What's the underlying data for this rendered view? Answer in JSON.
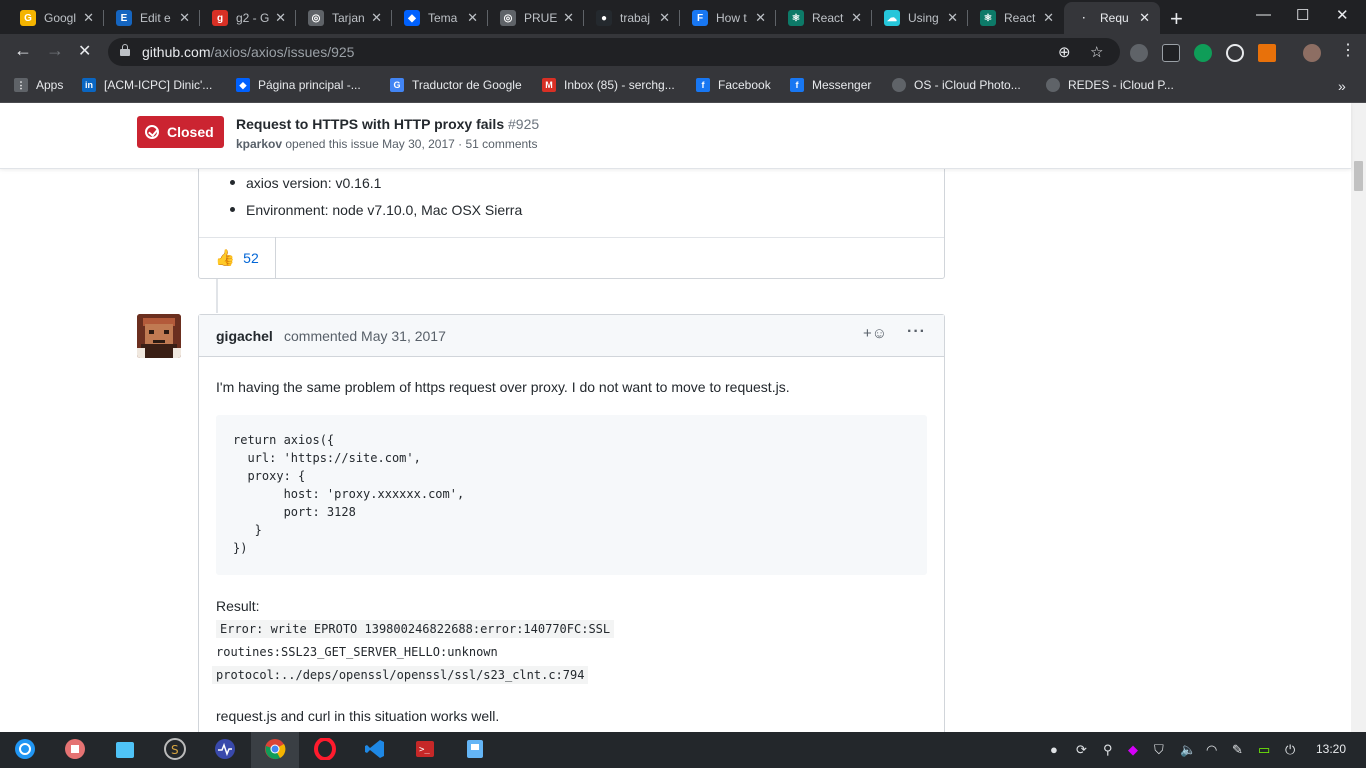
{
  "tabs": [
    {
      "label": "Googl",
      "fav_color": "#f4b400",
      "fav_char": "G"
    },
    {
      "label": "Edit e",
      "fav_color": "#1565c0",
      "fav_char": "E"
    },
    {
      "label": "g2 - G",
      "fav_color": "#d93025",
      "fav_char": "g"
    },
    {
      "label": "Tarjan",
      "fav_color": "#5f6368",
      "fav_char": "◎"
    },
    {
      "label": "Tema",
      "fav_color": "#0061fe",
      "fav_char": "◆"
    },
    {
      "label": "PRUE",
      "fav_color": "#5f6368",
      "fav_char": "◎"
    },
    {
      "label": "trabaj",
      "fav_color": "#24292e",
      "fav_char": "●"
    },
    {
      "label": "How t",
      "fav_color": "#1877f2",
      "fav_char": "F"
    },
    {
      "label": "React",
      "fav_color": "#0d7a68",
      "fav_char": "⚛"
    },
    {
      "label": "Using",
      "fav_color": "#26c6da",
      "fav_char": "☁"
    },
    {
      "label": "React",
      "fav_color": "#0d7a68",
      "fav_char": "⚛"
    },
    {
      "label": "Requ",
      "fav_color": "#35363a",
      "fav_char": "·"
    }
  ],
  "address": {
    "host": "github.com",
    "path": "/axios/axios/issues/925"
  },
  "bookmarks": [
    {
      "label": "Apps",
      "fav_color": "#5f6368",
      "fav_char": "⋮"
    },
    {
      "label": "[ACM-ICPC] Dinic'...",
      "fav_color": "#0a66c2",
      "fav_char": "in"
    },
    {
      "label": "Página principal -...",
      "fav_color": "#0061fe",
      "fav_char": "◆"
    },
    {
      "label": "Traductor de Google",
      "fav_color": "#4285f4",
      "fav_char": "G"
    },
    {
      "label": "Inbox (85) - serchg...",
      "fav_color": "#d93025",
      "fav_char": "M"
    },
    {
      "label": "Facebook",
      "fav_color": "#1877f2",
      "fav_char": "f"
    },
    {
      "label": "Messenger",
      "fav_color": "#1877f2",
      "fav_char": "f"
    },
    {
      "label": "OS - iCloud Photo...",
      "fav_color": "#5f6368",
      "fav_char": ""
    },
    {
      "label": "REDES - iCloud P...",
      "fav_color": "#5f6368",
      "fav_char": ""
    }
  ],
  "issue": {
    "state": "Closed",
    "title": "Request to HTTPS with HTTP proxy fails",
    "number": "#925",
    "author": "kparkov",
    "meta_rest": "opened this issue May 30, 2017 · 51 comments"
  },
  "first_comment": {
    "bullets": [
      "axios version: v0.16.1",
      "Environment: node v7.10.0, Mac OSX Sierra"
    ],
    "reaction_count": "52"
  },
  "comment": {
    "author": "gigachel",
    "verb": "commented May 31, 2017",
    "text1": "I'm having the same problem of https request over proxy. I do not want to move to request.js.",
    "code": [
      "return axios({",
      "  url: 'https://site.com',",
      "  proxy: {",
      "       host: 'proxy.xxxxxx.com',",
      "       port: 3128",
      "   }",
      "})"
    ],
    "result_label": "Result:",
    "error_lines": [
      "Error: write EPROTO 139800246822688:error:140770FC:SSL",
      "routines:SSL23_GET_SERVER_HELLO:unknown",
      "protocol:../deps/openssl/openssl/ssl/s23_clnt.c:794"
    ],
    "text2": "request.js and curl in this situation works well."
  },
  "clock": "13:20"
}
